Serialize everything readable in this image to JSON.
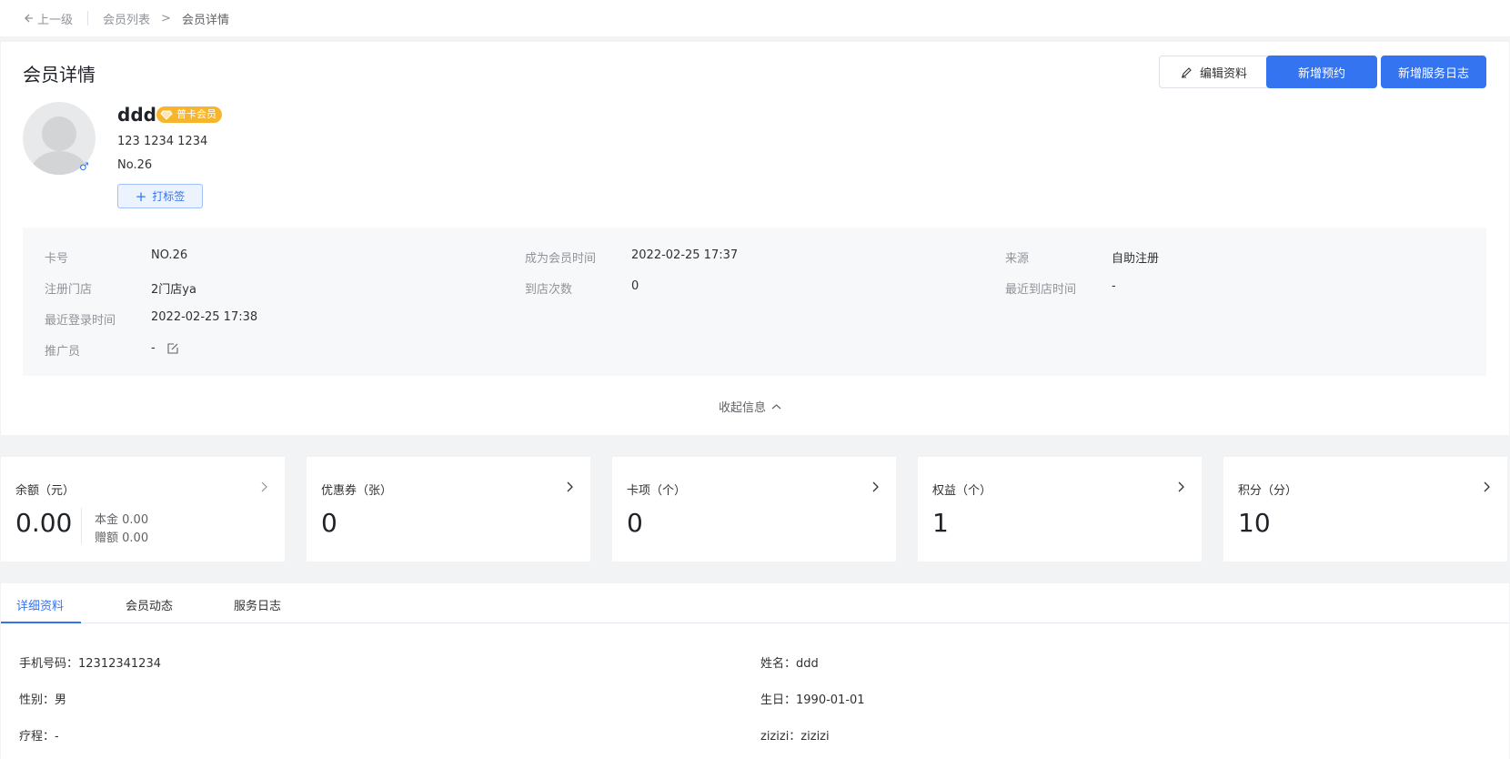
{
  "breadcrumb": {
    "back_label": "上一级",
    "items": [
      "会员列表",
      "会员详情"
    ],
    "separator": ">"
  },
  "header": {
    "title": "会员详情",
    "edit_button": "编辑资料",
    "new_appointment_button": "新增预约",
    "new_service_log_button": "新增服务日志"
  },
  "member": {
    "name": "ddd",
    "badge": "普卡会员",
    "phone": "123 1234 1234",
    "number": "No.26",
    "gender_symbol": "♂",
    "tag_button": "打标签"
  },
  "info": {
    "card_no_label": "卡号",
    "card_no": "NO.26",
    "join_time_label": "成为会员时间",
    "join_time": "2022-02-25 17:37",
    "source_label": "来源",
    "source": "自助注册",
    "store_label": "注册门店",
    "store": "2门店ya",
    "visits_label": "到店次数",
    "visits": "0",
    "last_visit_label": "最近到店时间",
    "last_visit": "-",
    "last_login_label": "最近登录时间",
    "last_login": "2022-02-25 17:38",
    "promoter_label": "推广员",
    "promoter": "-"
  },
  "collapse_label": "收起信息",
  "stats": {
    "balance": {
      "label": "余额（元）",
      "value": "0.00",
      "principal_label": "本金",
      "principal": "0.00",
      "bonus_label": "赠额",
      "bonus": "0.00"
    },
    "coupons": {
      "label": "优惠券（张）",
      "value": "0"
    },
    "cards": {
      "label": "卡项（个）",
      "value": "0"
    },
    "benefits": {
      "label": "权益（个）",
      "value": "1"
    },
    "points": {
      "label": "积分（分）",
      "value": "10"
    }
  },
  "tabs": [
    "详细资料",
    "会员动态",
    "服务日志"
  ],
  "details": {
    "phone": "手机号码：12312341234",
    "name": "姓名：ddd",
    "gender": "性别：男",
    "birthday": "生日：1990-01-01",
    "course": "疗程：-",
    "custom": "zizizi：zizizi"
  },
  "colors": {
    "primary": "#3574f0",
    "badge": "#f7b52c"
  }
}
